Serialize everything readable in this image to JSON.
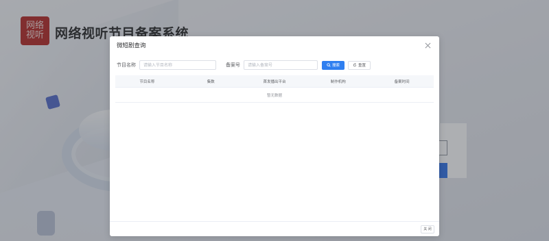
{
  "background": {
    "logo_text": "网络视听",
    "site_title": "网络视听节目备案系统"
  },
  "dialog": {
    "title": "微短剧查询",
    "close_icon": "close-icon",
    "filters": {
      "program_name_label": "节目名称",
      "program_name_placeholder": "请输入节目名称",
      "record_no_label": "备案号",
      "record_no_placeholder": "请输入备案号",
      "search_button": "搜索",
      "reset_button": "重置"
    },
    "table": {
      "columns": [
        "节目名称",
        "集数",
        "首发播出平台",
        "制作机构",
        "备案时间"
      ],
      "empty_text": "暂无数据"
    },
    "footer": {
      "close_button": "关 闭"
    }
  },
  "colors": {
    "primary": "#2f7ff0",
    "overlay": "rgba(60,64,72,0.42)",
    "logo_red": "#b3211e"
  }
}
